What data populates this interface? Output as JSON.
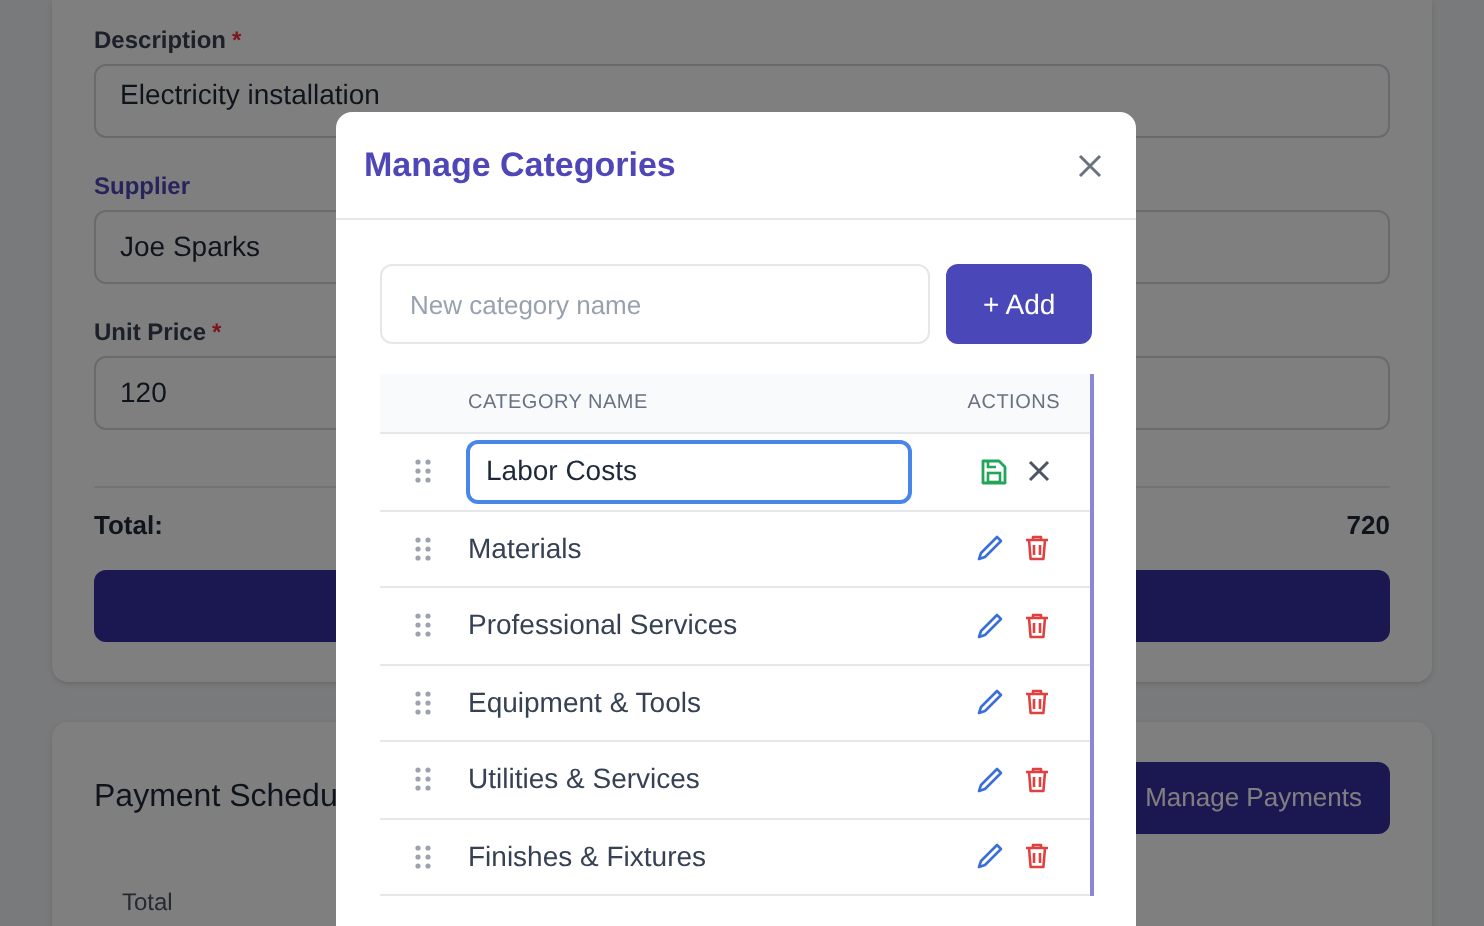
{
  "form": {
    "fields": [
      {
        "label": "Description",
        "required_mark": "*",
        "focused": false,
        "value": "Electricity installation"
      },
      {
        "label": "Supplier",
        "focused": true,
        "value": "Joe Sparks"
      },
      {
        "label": "Unit Price",
        "required_mark": "*",
        "focused": false,
        "value": "120"
      }
    ],
    "total_label": "Total:",
    "total_value": "720"
  },
  "payment_card": {
    "title": "Payment Schedu",
    "button": "Manage Payments",
    "column_1": "Total"
  },
  "modal": {
    "title": "Manage Categories",
    "input_placeholder": "New category name",
    "add_button": "+ Add",
    "columns": [
      "CATEGORY NAME",
      "ACTIONS"
    ],
    "rows": [
      {
        "name": "Labor Costs",
        "editing": true
      },
      {
        "name": "Materials",
        "editing": false
      },
      {
        "name": "Professional Services",
        "editing": false
      },
      {
        "name": "Equipment & Tools",
        "editing": false
      },
      {
        "name": "Utilities & Services",
        "editing": false
      },
      {
        "name": "Finishes & Fixtures",
        "editing": false
      }
    ]
  }
}
